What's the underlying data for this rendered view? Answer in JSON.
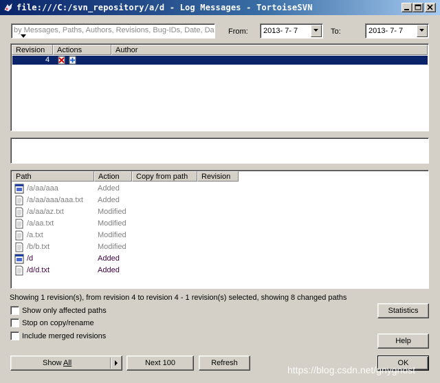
{
  "window": {
    "title": "file:///C:/svn_repository/a/d - Log Messages - TortoiseSVN"
  },
  "filter": {
    "placeholder": "by Messages, Paths, Authors, Revisions, Bug-IDs, Date, Date",
    "from_label": "From:",
    "from_value": "2013- 7- 7",
    "to_label": "To:",
    "to_value": "2013- 7- 7"
  },
  "revisions": {
    "columns": [
      "Revision",
      "Actions",
      "Author"
    ],
    "rows": [
      {
        "revision": "4",
        "actions": [
          "delete-action-icon",
          "add-action-icon"
        ],
        "author": ""
      }
    ]
  },
  "message": {
    "text": ""
  },
  "paths": {
    "columns": [
      "Path",
      "Action",
      "Copy from path",
      "Revision"
    ],
    "rows": [
      {
        "path": "/a/aa/aaa",
        "action": "Added",
        "icon": "folder-file-icon",
        "relevant": false
      },
      {
        "path": "/a/aa/aaa/aaa.txt",
        "action": "Added",
        "icon": "text-file-icon",
        "relevant": false
      },
      {
        "path": "/a/aa/az.txt",
        "action": "Modified",
        "icon": "text-file-icon",
        "relevant": false
      },
      {
        "path": "/a/aa.txt",
        "action": "Modified",
        "icon": "text-file-icon",
        "relevant": false
      },
      {
        "path": "/a.txt",
        "action": "Modified",
        "icon": "text-file-icon",
        "relevant": false
      },
      {
        "path": "/b/b.txt",
        "action": "Modified",
        "icon": "text-file-icon",
        "relevant": false
      },
      {
        "path": "/d",
        "action": "Added",
        "icon": "folder-file-icon",
        "relevant": true
      },
      {
        "path": "/d/d.txt",
        "action": "Added",
        "icon": "text-file-icon",
        "relevant": true
      }
    ]
  },
  "status": "Showing 1 revision(s), from revision 4 to revision 4 - 1 revision(s) selected, showing 8 changed paths",
  "options": {
    "show_affected": "Show only affected paths",
    "stop_on_copy": "Stop on copy/rename",
    "include_merged": "Include merged revisions"
  },
  "buttons": {
    "statistics": "Statistics",
    "help": "Help",
    "show_all_pre": "Show ",
    "show_all_ul": "All",
    "next_100": "Next 100",
    "refresh": "Refresh",
    "ok": "OK"
  },
  "watermark": "https://blog.csdn.net/gnygnost",
  "colors": {
    "titlebar_start": "#0a246a",
    "selection": "#0a246a",
    "dimmed_path": "#808080",
    "relevant_path": "#400040",
    "face": "#d4d0c8"
  }
}
